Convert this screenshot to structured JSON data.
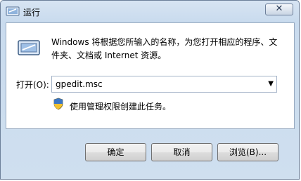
{
  "window": {
    "title": "运行",
    "close_glyph": "✕"
  },
  "content": {
    "icon": "run-program-icon",
    "description": "Windows 将根据您所输入的名称，为您打开相应的程序、文件夹、文档或 Internet 资源。",
    "open_label": "打开(O):",
    "open_value": "gpedit.msc",
    "dropdown_glyph": "▼",
    "admin_icon": "uac-shield-icon",
    "admin_note": "使用管理权限创建此任务。"
  },
  "buttons": {
    "ok": "确定",
    "cancel": "取消",
    "browse": "浏览(B)..."
  }
}
